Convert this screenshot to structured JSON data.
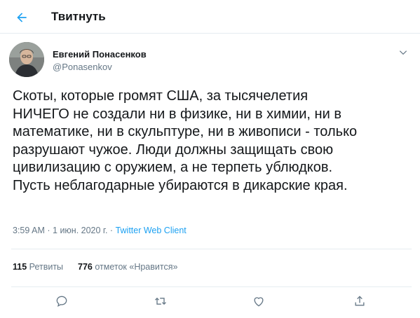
{
  "header": {
    "title": "Твитнуть",
    "back_icon": "arrow-left-icon",
    "accent_color": "#1da1f2"
  },
  "tweet": {
    "author": {
      "name": "Евгений Понасенков",
      "handle": "@Ponasenkov"
    },
    "text_lines": [
      "Скоты, которые громят США, за тысячелетия",
      "НИЧЕГО не создали ни в физике, ни в химии, ни в",
      "математике, ни в скульптуре, ни в живописи - только",
      "разрушают чужое. Люди должны защищать свою",
      "цивилизацию с оружием, а не терпеть ублюдков.",
      "Пусть неблагодарные убираются в дикарские края."
    ],
    "time": "3:59 AM",
    "separator": "·",
    "date": "1 июн. 2020 г.",
    "source": "Twitter Web Client"
  },
  "stats": {
    "retweets_count": "115",
    "retweets_label": "Ретвиты",
    "likes_count": "776",
    "likes_label": "отметок «Нравится»"
  },
  "actions": {
    "reply_icon": "reply-icon",
    "retweet_icon": "retweet-icon",
    "like_icon": "heart-icon",
    "share_icon": "share-icon"
  }
}
